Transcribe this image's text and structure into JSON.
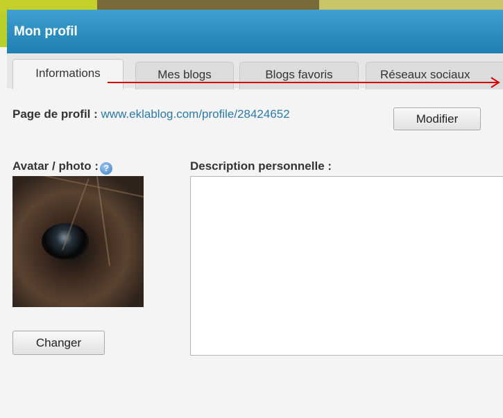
{
  "header": {
    "title": "Mon profil"
  },
  "tabs": [
    {
      "label": "Informations",
      "active": true
    },
    {
      "label": "Mes blogs"
    },
    {
      "label": "Blogs favoris"
    },
    {
      "label": "Réseaux sociaux"
    }
  ],
  "profile": {
    "label": "Page de profil : ",
    "url": "www.eklablog.com/profile/28424652",
    "modify_button": "Modifier"
  },
  "avatar": {
    "label": "Avatar / photo :",
    "help_icon": "help-icon",
    "change_button": "Changer"
  },
  "description": {
    "label": "Description personnelle :",
    "value": ""
  },
  "colors": {
    "header_blue": "#2a8fc0",
    "link_blue": "#2b7aa8",
    "annotation_red": "#d40000"
  }
}
